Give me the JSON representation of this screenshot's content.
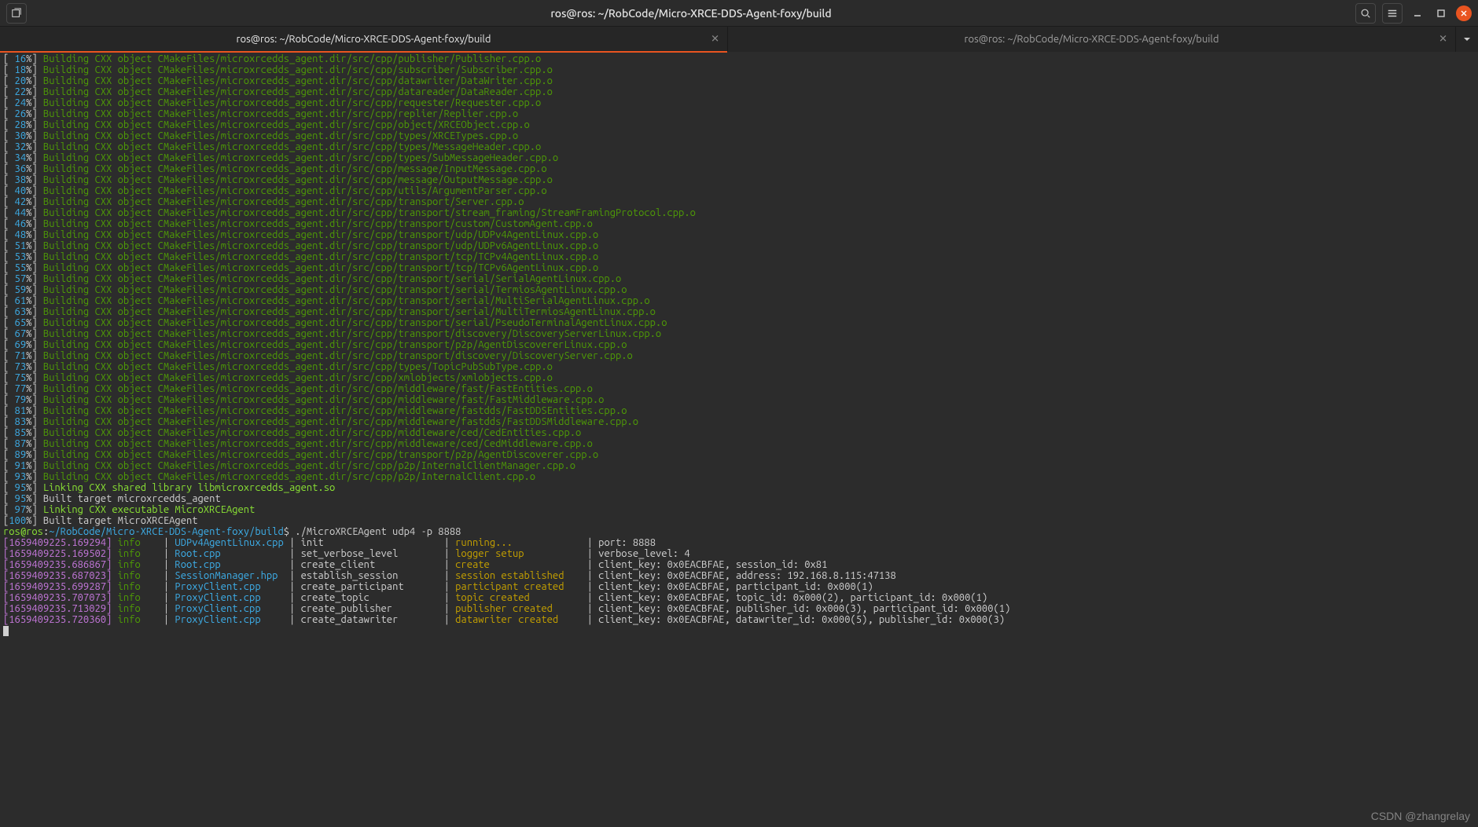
{
  "window": {
    "title": "ros@ros: ~/RobCode/Micro-XRCE-DDS-Agent-foxy/build"
  },
  "tabs": [
    {
      "label": "ros@ros: ~/RobCode/Micro-XRCE-DDS-Agent-foxy/build",
      "active": true
    },
    {
      "label": "ros@ros: ~/RobCode/Micro-XRCE-DDS-Agent-foxy/build",
      "active": false
    }
  ],
  "build_lines": [
    {
      "pct": "16%",
      "text": "Building CXX object CMakeFiles/microxrcedds_agent.dir/src/cpp/publisher/Publisher.cpp.o",
      "style": "green"
    },
    {
      "pct": "18%",
      "text": "Building CXX object CMakeFiles/microxrcedds_agent.dir/src/cpp/subscriber/Subscriber.cpp.o",
      "style": "green"
    },
    {
      "pct": "20%",
      "text": "Building CXX object CMakeFiles/microxrcedds_agent.dir/src/cpp/datawriter/DataWriter.cpp.o",
      "style": "green"
    },
    {
      "pct": "22%",
      "text": "Building CXX object CMakeFiles/microxrcedds_agent.dir/src/cpp/datareader/DataReader.cpp.o",
      "style": "green"
    },
    {
      "pct": "24%",
      "text": "Building CXX object CMakeFiles/microxrcedds_agent.dir/src/cpp/requester/Requester.cpp.o",
      "style": "green"
    },
    {
      "pct": "26%",
      "text": "Building CXX object CMakeFiles/microxrcedds_agent.dir/src/cpp/replier/Replier.cpp.o",
      "style": "green"
    },
    {
      "pct": "28%",
      "text": "Building CXX object CMakeFiles/microxrcedds_agent.dir/src/cpp/object/XRCEObject.cpp.o",
      "style": "green"
    },
    {
      "pct": "30%",
      "text": "Building CXX object CMakeFiles/microxrcedds_agent.dir/src/cpp/types/XRCETypes.cpp.o",
      "style": "green"
    },
    {
      "pct": "32%",
      "text": "Building CXX object CMakeFiles/microxrcedds_agent.dir/src/cpp/types/MessageHeader.cpp.o",
      "style": "green"
    },
    {
      "pct": "34%",
      "text": "Building CXX object CMakeFiles/microxrcedds_agent.dir/src/cpp/types/SubMessageHeader.cpp.o",
      "style": "green"
    },
    {
      "pct": "36%",
      "text": "Building CXX object CMakeFiles/microxrcedds_agent.dir/src/cpp/message/InputMessage.cpp.o",
      "style": "green"
    },
    {
      "pct": "38%",
      "text": "Building CXX object CMakeFiles/microxrcedds_agent.dir/src/cpp/message/OutputMessage.cpp.o",
      "style": "green"
    },
    {
      "pct": "40%",
      "text": "Building CXX object CMakeFiles/microxrcedds_agent.dir/src/cpp/utils/ArgumentParser.cpp.o",
      "style": "green"
    },
    {
      "pct": "42%",
      "text": "Building CXX object CMakeFiles/microxrcedds_agent.dir/src/cpp/transport/Server.cpp.o",
      "style": "green"
    },
    {
      "pct": "44%",
      "text": "Building CXX object CMakeFiles/microxrcedds_agent.dir/src/cpp/transport/stream_framing/StreamFramingProtocol.cpp.o",
      "style": "green"
    },
    {
      "pct": "46%",
      "text": "Building CXX object CMakeFiles/microxrcedds_agent.dir/src/cpp/transport/custom/CustomAgent.cpp.o",
      "style": "green"
    },
    {
      "pct": "48%",
      "text": "Building CXX object CMakeFiles/microxrcedds_agent.dir/src/cpp/transport/udp/UDPv4AgentLinux.cpp.o",
      "style": "green"
    },
    {
      "pct": "51%",
      "text": "Building CXX object CMakeFiles/microxrcedds_agent.dir/src/cpp/transport/udp/UDPv6AgentLinux.cpp.o",
      "style": "green"
    },
    {
      "pct": "53%",
      "text": "Building CXX object CMakeFiles/microxrcedds_agent.dir/src/cpp/transport/tcp/TCPv4AgentLinux.cpp.o",
      "style": "green"
    },
    {
      "pct": "55%",
      "text": "Building CXX object CMakeFiles/microxrcedds_agent.dir/src/cpp/transport/tcp/TCPv6AgentLinux.cpp.o",
      "style": "green"
    },
    {
      "pct": "57%",
      "text": "Building CXX object CMakeFiles/microxrcedds_agent.dir/src/cpp/transport/serial/SerialAgentLinux.cpp.o",
      "style": "green"
    },
    {
      "pct": "59%",
      "text": "Building CXX object CMakeFiles/microxrcedds_agent.dir/src/cpp/transport/serial/TermiosAgentLinux.cpp.o",
      "style": "green"
    },
    {
      "pct": "61%",
      "text": "Building CXX object CMakeFiles/microxrcedds_agent.dir/src/cpp/transport/serial/MultiSerialAgentLinux.cpp.o",
      "style": "green"
    },
    {
      "pct": "63%",
      "text": "Building CXX object CMakeFiles/microxrcedds_agent.dir/src/cpp/transport/serial/MultiTermiosAgentLinux.cpp.o",
      "style": "green"
    },
    {
      "pct": "65%",
      "text": "Building CXX object CMakeFiles/microxrcedds_agent.dir/src/cpp/transport/serial/PseudoTerminalAgentLinux.cpp.o",
      "style": "green"
    },
    {
      "pct": "67%",
      "text": "Building CXX object CMakeFiles/microxrcedds_agent.dir/src/cpp/transport/discovery/DiscoveryServerLinux.cpp.o",
      "style": "green"
    },
    {
      "pct": "69%",
      "text": "Building CXX object CMakeFiles/microxrcedds_agent.dir/src/cpp/transport/p2p/AgentDiscovererLinux.cpp.o",
      "style": "green"
    },
    {
      "pct": "71%",
      "text": "Building CXX object CMakeFiles/microxrcedds_agent.dir/src/cpp/transport/discovery/DiscoveryServer.cpp.o",
      "style": "green"
    },
    {
      "pct": "73%",
      "text": "Building CXX object CMakeFiles/microxrcedds_agent.dir/src/cpp/types/TopicPubSubType.cpp.o",
      "style": "green"
    },
    {
      "pct": "75%",
      "text": "Building CXX object CMakeFiles/microxrcedds_agent.dir/src/cpp/xmlobjects/xmlobjects.cpp.o",
      "style": "green"
    },
    {
      "pct": "77%",
      "text": "Building CXX object CMakeFiles/microxrcedds_agent.dir/src/cpp/middleware/fast/FastEntities.cpp.o",
      "style": "green"
    },
    {
      "pct": "79%",
      "text": "Building CXX object CMakeFiles/microxrcedds_agent.dir/src/cpp/middleware/fast/FastMiddleware.cpp.o",
      "style": "green"
    },
    {
      "pct": "81%",
      "text": "Building CXX object CMakeFiles/microxrcedds_agent.dir/src/cpp/middleware/fastdds/FastDDSEntities.cpp.o",
      "style": "green"
    },
    {
      "pct": "83%",
      "text": "Building CXX object CMakeFiles/microxrcedds_agent.dir/src/cpp/middleware/fastdds/FastDDSMiddleware.cpp.o",
      "style": "green"
    },
    {
      "pct": "85%",
      "text": "Building CXX object CMakeFiles/microxrcedds_agent.dir/src/cpp/middleware/ced/CedEntities.cpp.o",
      "style": "green"
    },
    {
      "pct": "87%",
      "text": "Building CXX object CMakeFiles/microxrcedds_agent.dir/src/cpp/middleware/ced/CedMiddleware.cpp.o",
      "style": "green"
    },
    {
      "pct": "89%",
      "text": "Building CXX object CMakeFiles/microxrcedds_agent.dir/src/cpp/transport/p2p/AgentDiscoverer.cpp.o",
      "style": "green"
    },
    {
      "pct": "91%",
      "text": "Building CXX object CMakeFiles/microxrcedds_agent.dir/src/cpp/p2p/InternalClientManager.cpp.o",
      "style": "green"
    },
    {
      "pct": "93%",
      "text": "Building CXX object CMakeFiles/microxrcedds_agent.dir/src/cpp/p2p/InternalClient.cpp.o",
      "style": "green"
    },
    {
      "pct": "95%",
      "text": "Linking CXX shared library libmicroxrcedds_agent.so",
      "style": "brightgreen"
    },
    {
      "pct": "95%",
      "text": "Built target microxrcedds_agent",
      "style": "white"
    },
    {
      "pct": "97%",
      "text": "Linking CXX executable MicroXRCEAgent",
      "style": "brightgreen"
    },
    {
      "pct": "100%",
      "text": "Built target MicroXRCEAgent",
      "style": "white"
    }
  ],
  "prompt": {
    "user": "ros@ros",
    "sep": ":",
    "path": "~/RobCode/Micro-XRCE-DDS-Agent-foxy/build",
    "dollar": "$",
    "command": "./MicroXRCEAgent udp4 -p 8888"
  },
  "log_lines": [
    {
      "ts": "[1659409225.169294]",
      "lvl": "info",
      "src": "UDPv4AgentLinux.cpp",
      "action": "init",
      "status": "running...",
      "extra": "port: 8888"
    },
    {
      "ts": "[1659409225.169502]",
      "lvl": "info",
      "src": "Root.cpp",
      "action": "set_verbose_level",
      "status": "logger setup",
      "extra": "verbose_level: 4"
    },
    {
      "ts": "[1659409235.686867]",
      "lvl": "info",
      "src": "Root.cpp",
      "action": "create_client",
      "status": "create",
      "extra": "client_key: 0x0EACBFAE, session_id: 0x81"
    },
    {
      "ts": "[1659409235.687023]",
      "lvl": "info",
      "src": "SessionManager.hpp",
      "action": "establish_session",
      "status": "session established",
      "extra": "client_key: 0x0EACBFAE, address: 192.168.8.115:47138"
    },
    {
      "ts": "[1659409235.699287]",
      "lvl": "info",
      "src": "ProxyClient.cpp",
      "action": "create_participant",
      "status": "participant created",
      "extra": "client_key: 0x0EACBFAE, participant_id: 0x000(1)"
    },
    {
      "ts": "[1659409235.707073]",
      "lvl": "info",
      "src": "ProxyClient.cpp",
      "action": "create_topic",
      "status": "topic created",
      "extra": "client_key: 0x0EACBFAE, topic_id: 0x000(2), participant_id: 0x000(1)"
    },
    {
      "ts": "[1659409235.713029]",
      "lvl": "info",
      "src": "ProxyClient.cpp",
      "action": "create_publisher",
      "status": "publisher created",
      "extra": "client_key: 0x0EACBFAE, publisher_id: 0x000(3), participant_id: 0x000(1)"
    },
    {
      "ts": "[1659409235.720360]",
      "lvl": "info",
      "src": "ProxyClient.cpp",
      "action": "create_datawriter",
      "status": "datawriter created",
      "extra": "client_key: 0x0EACBFAE, datawriter_id: 0x000(5), publisher_id: 0x000(3)"
    }
  ],
  "watermark": "CSDN @zhangrelay"
}
